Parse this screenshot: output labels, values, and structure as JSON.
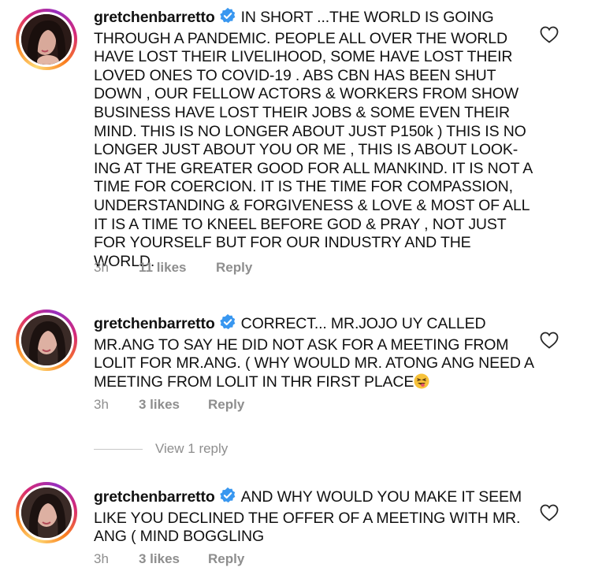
{
  "comments": [
    {
      "username": "gretchenbarretto",
      "text": "IN SHORT ...THE WORLD IS GOING THROUGH A PANDEMIC. PEOPLE ALL OVER THE WORLD HAVE LOST THEIR LIVELIHOOD, SOME HAVE LOST THEIR LOVED ONES  TO COVID-19 . ABS CBN HAS BEEN SHUT DOWN , OUR FELLOW ACTORS & WORKERS FROM SHOW BUSINESS HAVE LOST THEIR JOBS & SOME EVEN THEIR MIND. THIS IS NO LONGER ABOUT JUST P150k ) THIS IS NO LONGER JUST ABOUT YOU OR ME , THIS IS ABOUT LOOK-ING AT THE GREATER GOOD FOR ALL MANKIND. IT IS NOT A TIME FOR COERCION. IT IS THE TIME FOR COMPASSION, UNDERSTANDING & FORGIVENESS & LOVE & MOST OF ALL IT IS A TIME TO KNEEL BEFORE GOD & PRAY , NOT JUST FOR YOURSELF BUT FOR OUR INDUSTRY AND THE WORLD.",
      "time": "3h",
      "likes": "11 likes",
      "reply_label": "Reply"
    },
    {
      "username": "gretchenbarretto",
      "text": "CORRECT... MR.JOJO UY CALLED MR.ANG TO SAY HE DID NOT ASK FOR A MEETING FROM LOLIT FOR MR.ANG. ( WHY WOULD MR. ATONG ANG NEED A MEETING FROM LOLIT IN THR FIRST PLACE",
      "emoji": "grinning-squinting-tongue-emoji",
      "time": "3h",
      "likes": "3 likes",
      "reply_label": "Reply"
    },
    {
      "username": "gretchenbarretto",
      "text": "AND WHY WOULD YOU MAKE IT SEEM LIKE YOU DECLINED THE OFFER OF A MEETING WITH MR. ANG ( MIND BOGGLING",
      "time": "3h",
      "likes": "3 likes",
      "reply_label": "Reply"
    }
  ],
  "view_replies_label": "View 1 reply",
  "icons": {
    "heart": "heart-outline-icon",
    "verified": "verified-badge-icon",
    "avatar": "avatar"
  },
  "colors": {
    "verified": "#3897f0",
    "meta": "#8e8e8e",
    "text": "#111111"
  }
}
